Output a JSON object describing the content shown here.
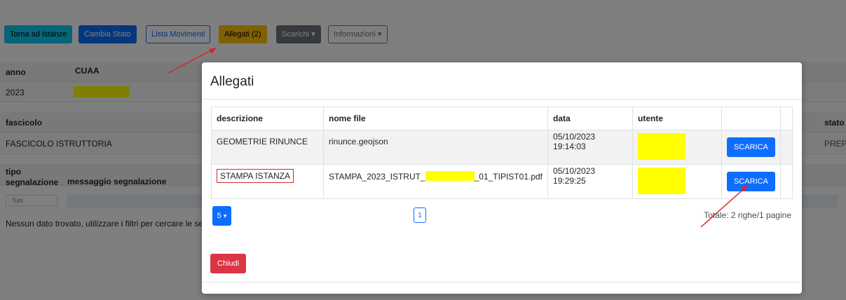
{
  "toolbar": {
    "back_label": "Torna ad Istanze",
    "change_state_label": "Cambia Stato",
    "movements_label": "Lista Movimenti",
    "attachments_label": "Allegati (2)",
    "downloads_label": "Scarichi",
    "info_label": "Informazioni"
  },
  "background": {
    "anno_header": "anno",
    "cuaa_header": "CUAA",
    "anno_value": "2023",
    "fascicolo_header": "fascicolo",
    "stato_header": "stato",
    "fascicolo_value": "FASCICOLO ISTRUTTORIA",
    "stato_value": "PREPA",
    "tipo_header_1": "tipo",
    "tipo_header_2": "segnalazione",
    "messaggio_header": "messaggio segnalazione",
    "filter_value": "Tutti",
    "empty_message": "Nessun dato trovato, utilizzare i filtri per cercare le se"
  },
  "modal": {
    "title": "Allegati",
    "columns": [
      "descrizione",
      "nome file",
      "data",
      "utente"
    ],
    "rows": [
      {
        "descrizione": "GEOMETRIE RINUNCE",
        "file_prefix": "rinunce.geojson",
        "file_suffix": "",
        "data": "05/10/2023 19:14:03",
        "action": "SCARICA"
      },
      {
        "descrizione": "STAMPA ISTANZA",
        "file_prefix": "STAMPA_2023_ISTRUT_",
        "file_suffix": "_01_TIPIST01.pdf",
        "data": "05/10/2023 19:29:25",
        "action": "SCARICA"
      }
    ],
    "page_size": "5",
    "current_page": "1",
    "total": "Totale: 2 righe/1 pagine",
    "close_label": "Chiudi"
  },
  "colors": {
    "primary": "#0d6efd",
    "danger": "#dc3545",
    "highlight": "#ffff00",
    "annotation": "#d62728",
    "warning": "#ffc107",
    "info": "#0dcaf0"
  },
  "icons": [
    "caret-down-icon",
    "annotation-arrow-icon"
  ]
}
